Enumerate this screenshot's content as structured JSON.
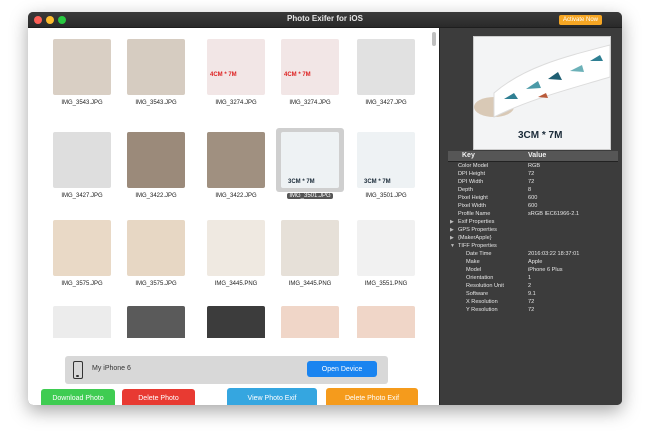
{
  "window": {
    "title": "Photo Exifer for iOS",
    "activate_label": "Activate Now"
  },
  "photos": [
    {
      "name": "IMG_3543.JPG",
      "color": "#d9cfc4"
    },
    {
      "name": "IMG_3543.JPG",
      "color": "#d6ccc1"
    },
    {
      "name": "IMG_3274.JPG",
      "color": "#f2e6e6",
      "overlay": "4CM * 7M"
    },
    {
      "name": "IMG_3274.JPG",
      "color": "#f2e6e6",
      "overlay": "4CM * 7M"
    },
    {
      "name": "IMG_3427.JPG",
      "color": "#e1e1e1"
    },
    {
      "name": "IMG_3427.JPG",
      "color": "#dedede"
    },
    {
      "name": "IMG_3422.JPG",
      "color": "#9b8a7a"
    },
    {
      "name": "IMG_3422.JPG",
      "color": "#a09080"
    },
    {
      "name": "IMG_3501.JPG",
      "color": "#eef2f4",
      "overlay": "3CM * 7M",
      "selected": true
    },
    {
      "name": "IMG_3501.JPG",
      "color": "#eef2f4",
      "overlay": "3CM * 7M"
    },
    {
      "name": "IMG_3575.JPG",
      "color": "#e9d9c6"
    },
    {
      "name": "IMG_3575.JPG",
      "color": "#e7d7c4"
    },
    {
      "name": "IMG_3445.PNG",
      "color": "#efe9e1"
    },
    {
      "name": "IMG_3445.PNG",
      "color": "#e6e0d8"
    },
    {
      "name": "IMG_3551.PNG",
      "color": "#f1f1f1"
    },
    {
      "name": "",
      "color": "#ececec"
    },
    {
      "name": "",
      "color": "#5a5a5a"
    },
    {
      "name": "",
      "color": "#3c3c3c"
    },
    {
      "name": "",
      "color": "#f0d6c8"
    },
    {
      "name": "",
      "color": "#f0d6c8"
    }
  ],
  "device": {
    "name": "My iPhone 6",
    "open_label": "Open Device"
  },
  "actions": {
    "download_label": "Download Photo",
    "delete_label": "Delete Photo",
    "view_exif_label": "View Photo Exif",
    "delete_exif_label": "Delete Photo Exif"
  },
  "colors": {
    "download": "#3fcc52",
    "delete": "#e83a32",
    "view_exif": "#35a6e0",
    "delete_exif": "#f59b1c",
    "open": "#1a84f0"
  },
  "preview": {
    "overlay": "3CM * 7M"
  },
  "exif": {
    "key_header": "Key",
    "value_header": "Value",
    "rows": [
      {
        "key": "Color Model",
        "value": "RGB",
        "indent": 0
      },
      {
        "key": "DPI Height",
        "value": "72",
        "indent": 0
      },
      {
        "key": "DPI Width",
        "value": "72",
        "indent": 0
      },
      {
        "key": "Depth",
        "value": "8",
        "indent": 0
      },
      {
        "key": "Pixel Height",
        "value": "600",
        "indent": 0
      },
      {
        "key": "Pixel Width",
        "value": "600",
        "indent": 0
      },
      {
        "key": "Profile Name",
        "value": "sRGB IEC61966-2.1",
        "indent": 0
      },
      {
        "key": "Exif Properties",
        "value": "",
        "indent": 0,
        "group": "collapsed"
      },
      {
        "key": "GPS Properties",
        "value": "",
        "indent": 0,
        "group": "collapsed"
      },
      {
        "key": "{MakerApple}",
        "value": "",
        "indent": 0,
        "group": "collapsed"
      },
      {
        "key": "TIFF Properties",
        "value": "",
        "indent": 0,
        "group": "expanded"
      },
      {
        "key": "Date Time",
        "value": "2016:03:22 18:37:01",
        "indent": 1
      },
      {
        "key": "Make",
        "value": "Apple",
        "indent": 1
      },
      {
        "key": "Model",
        "value": "iPhone 6 Plus",
        "indent": 1
      },
      {
        "key": "Orientation",
        "value": "1",
        "indent": 1
      },
      {
        "key": "Resolution Unit",
        "value": "2",
        "indent": 1
      },
      {
        "key": "Software",
        "value": "9.1",
        "indent": 1
      },
      {
        "key": "X Resolution",
        "value": "72",
        "indent": 1
      },
      {
        "key": "Y Resolution",
        "value": "72",
        "indent": 1
      }
    ]
  }
}
